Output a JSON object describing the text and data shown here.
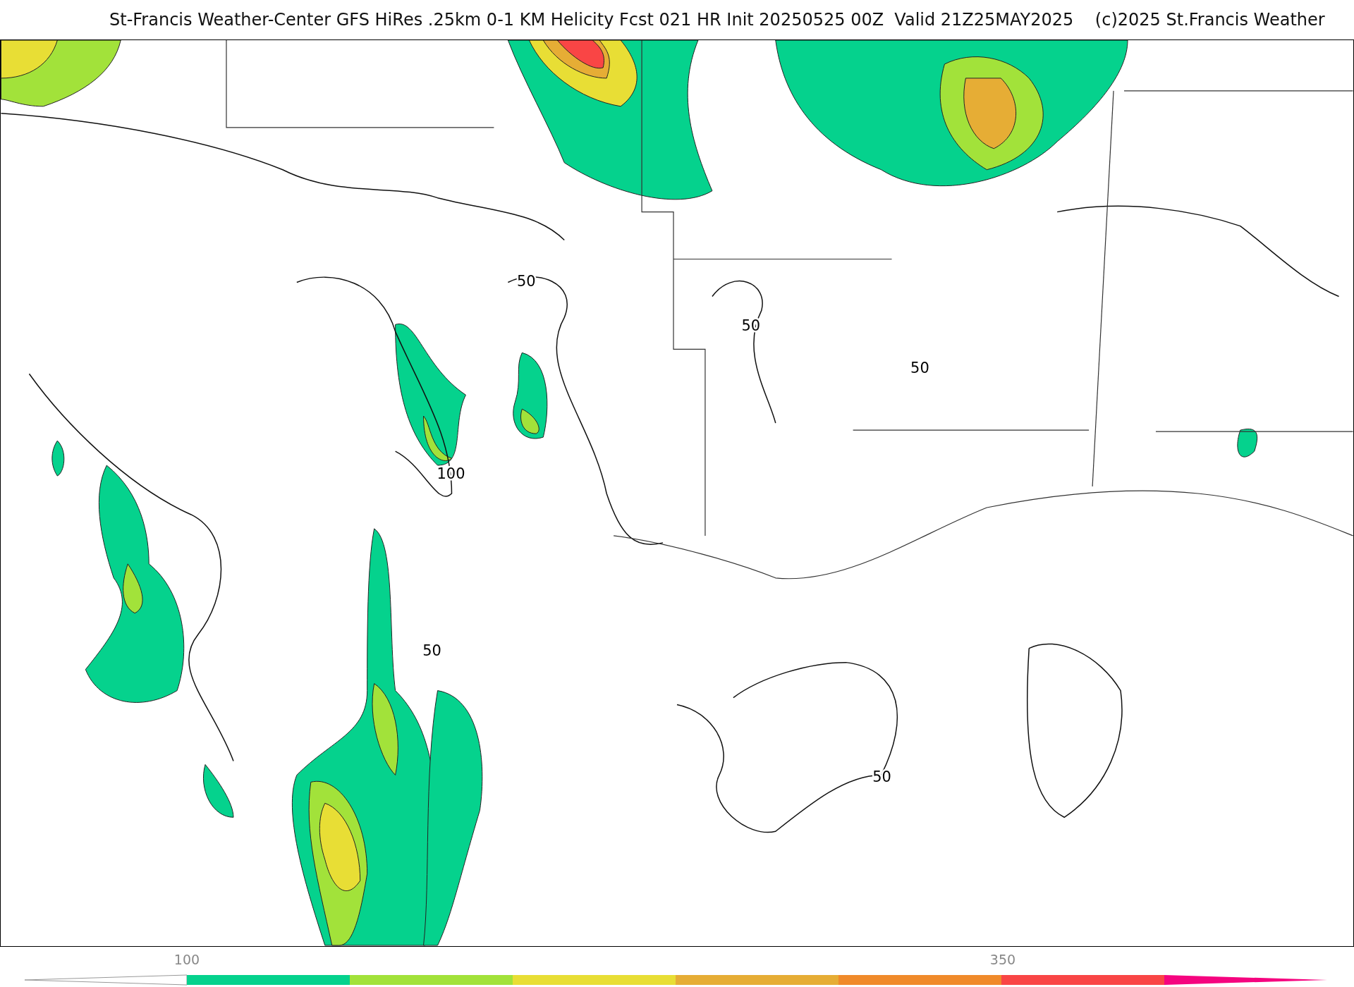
{
  "title": "St-Francis Weather-Center GFS HiRes .25km 0-1 KM Helicity Fcst 021 HR Init 20250525 00Z  Valid 21Z25MAY2025    (c)2025 St.Francis Weather",
  "contour_labels": [
    "50",
    "50",
    "50",
    "100",
    "50",
    "50"
  ],
  "colorbar": {
    "tick_labels": [
      "100",
      "350"
    ],
    "segments": [
      {
        "color": "#05d28d"
      },
      {
        "color": "#a2e23a"
      },
      {
        "color": "#e8de35"
      },
      {
        "color": "#e6ad35"
      },
      {
        "color": "#f08a2a"
      },
      {
        "color": "#f94545"
      },
      {
        "color": "#f5047f"
      }
    ]
  }
}
